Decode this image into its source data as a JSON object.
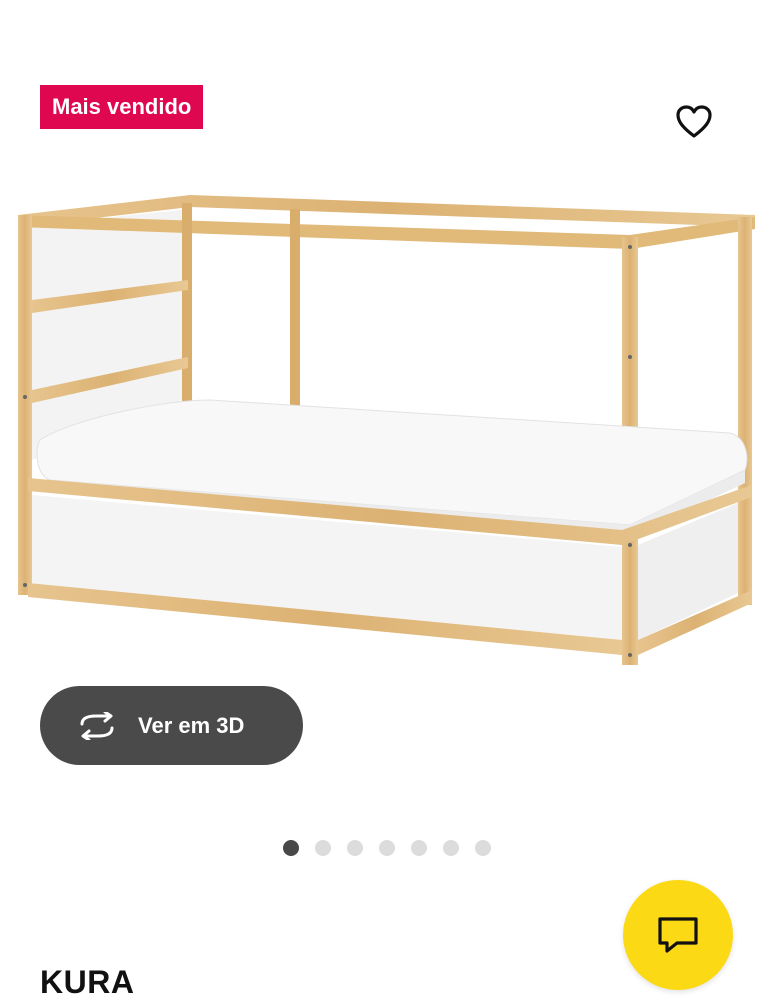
{
  "badge": {
    "label": "Mais vendido",
    "color": "#e00751"
  },
  "favorite": {
    "icon": "heart-outline-icon"
  },
  "product_image": {
    "description_icon": "bunk-bed-image"
  },
  "view3d": {
    "label": "Ver em 3D",
    "icon": "rotate-3d-icon"
  },
  "carousel": {
    "total": 7,
    "active_index": 0
  },
  "chat": {
    "icon": "chat-bubble-icon",
    "color": "#fbd914"
  },
  "product": {
    "name": "KURA"
  }
}
